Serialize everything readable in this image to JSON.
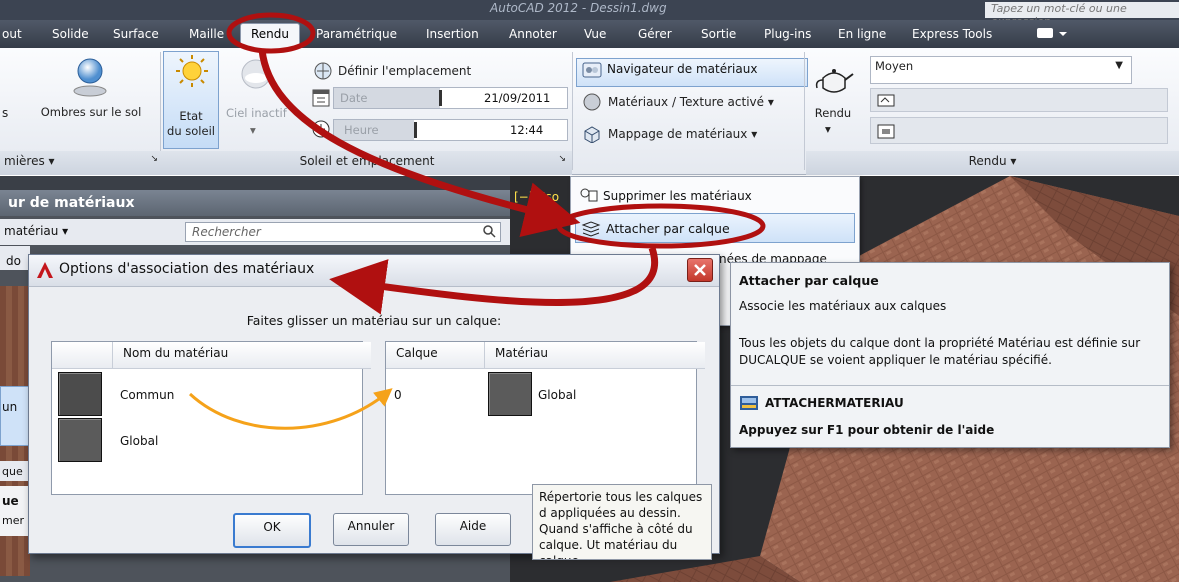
{
  "titlebar": {
    "title": "AutoCAD 2012 - Dessin1.dwg",
    "help_search_placeholder": "Tapez un mot-clé ou une expression"
  },
  "menubar": {
    "items": [
      "out",
      "Solide",
      "Surface",
      "Maille",
      "Rendu",
      "Paramétrique",
      "Insertion",
      "Annoter",
      "Vue",
      "Gérer",
      "Sortie",
      "Plug-ins",
      "En ligne",
      "Express Tools"
    ],
    "active": "Rendu"
  },
  "ribbon": {
    "lights_panel": {
      "shadows_label": "Ombres sur le sol",
      "panel_title": "mières",
      "prefix": "s"
    },
    "sun_panel": {
      "etat_label_1": "Etat",
      "etat_label_2": "du soleil",
      "ciel_label": "Ciel inactif",
      "location_label": "Définir l'emplacement",
      "date_label": "Date",
      "date_value": "21/09/2011",
      "hour_label": "Heure",
      "hour_value": "12:44",
      "panel_title": "Soleil et emplacement"
    },
    "materials_panel": {
      "browser_label": "Navigateur de matériaux",
      "texture_label": "Matériaux / Texture activé",
      "mapping_label": "Mappage de matériaux"
    },
    "render_panel": {
      "render_label": "Rendu",
      "quality_value": "Moyen",
      "panel_title": "Rendu"
    }
  },
  "dropdown": {
    "items": [
      "Supprimer les matériaux",
      "Attacher par calque",
      "nées de mappage"
    ]
  },
  "palette": {
    "title": "ur de matériaux",
    "filter_label": "matériau",
    "search_placeholder": "Rechercher",
    "side_texts": [
      "do",
      "un",
      "que",
      "ue",
      "mer"
    ]
  },
  "viewport": {
    "label": "[−] [Iso"
  },
  "dialog": {
    "title": "Options d'association des matériaux",
    "instruction": "Faites glisser un matériau sur un calque:",
    "left_header": "Nom du matériau",
    "materials": [
      {
        "name": "Commun"
      },
      {
        "name": "Global"
      }
    ],
    "right_headers": {
      "layer": "Calque",
      "material": "Matériau"
    },
    "assignments": [
      {
        "layer": "0",
        "material": "Global"
      }
    ],
    "buttons": {
      "ok": "OK",
      "cancel": "Annuler",
      "help": "Aide"
    }
  },
  "tooltip": {
    "title": "Attacher par calque",
    "summary": "Associe les matériaux aux calques",
    "description": "Tous les objets du calque dont la propriété Matériau est définie sur DUCALQUE se voient appliquer le matériau spécifié.",
    "command": "ATTACHERMATERIAU",
    "help_hint": "Appuyez sur F1 pour obtenir de l'aide"
  },
  "tooltip2": {
    "text": "Répertorie tous les calques d appliquées au dessin. Quand s'affiche à côté du calque. Ut matériau du calque."
  },
  "colors": {
    "annotation_red": "#b01010",
    "annotation_orange": "#f5a21a",
    "ribbon_selected": "#cfe2f8",
    "menubar_dark": "#3c4452"
  }
}
